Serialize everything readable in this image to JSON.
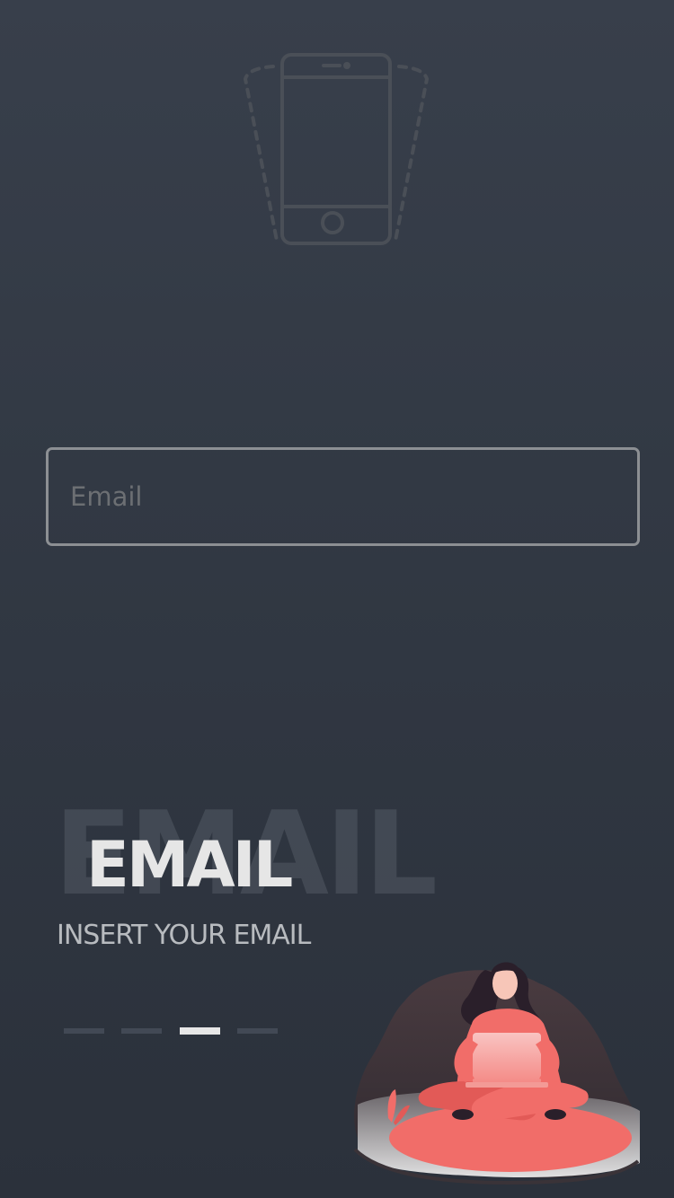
{
  "email_field": {
    "placeholder": "Email",
    "value": ""
  },
  "heading": {
    "title": "EMAIL",
    "background_title": "EMAIL",
    "subtitle": "INSERT YOUR EMAIL"
  },
  "pager": {
    "count": 4,
    "active_index": 2
  },
  "icons": {
    "top": "phone-shake-icon",
    "illustration": "woman-with-laptop-illustration"
  },
  "colors": {
    "background_top": "#383f4b",
    "background_bottom": "#2b313b",
    "accent": "#f16d69",
    "text_primary": "#e6e6e6",
    "input_border": "#8c8f93"
  }
}
